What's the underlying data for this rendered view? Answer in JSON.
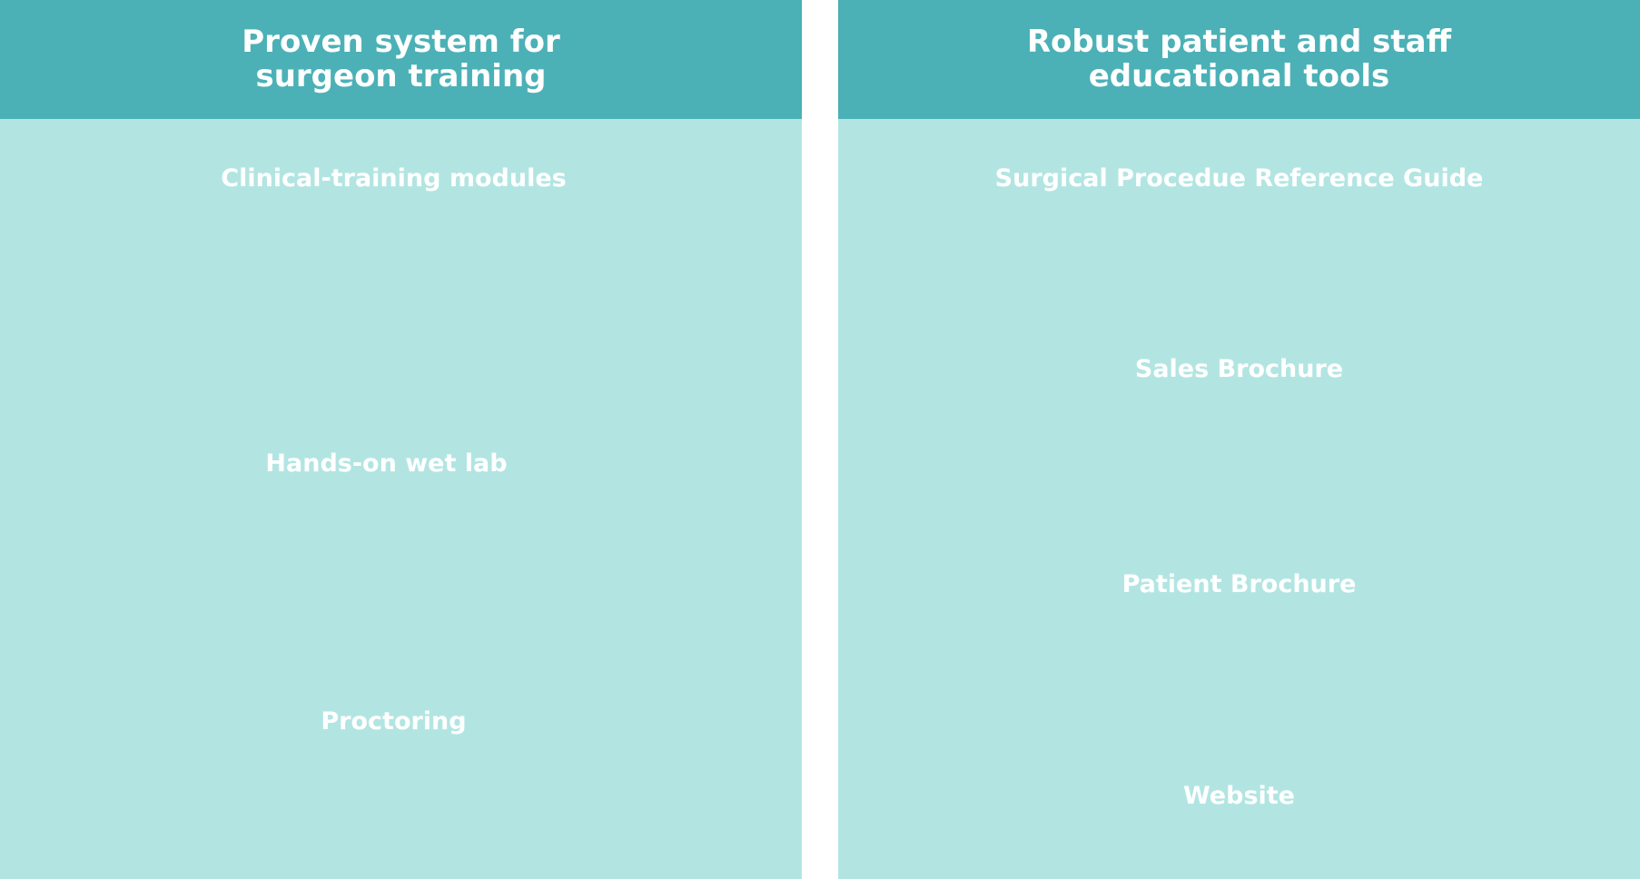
{
  "colors": {
    "header_bg": "#4bb1b6",
    "panel_bg": "#b2e5e2",
    "text": "#ffffff",
    "gutter": "#ffffff"
  },
  "left": {
    "title": "Proven system for\nsurgeon training",
    "items": [
      "Clinical-training modules",
      "Hands-on wet lab",
      "Proctoring"
    ]
  },
  "right": {
    "title": "Robust patient and staff\neducational tools",
    "items": [
      "Surgical Procedue Reference Guide",
      "Sales Brochure",
      "Patient Brochure",
      "Website"
    ]
  }
}
